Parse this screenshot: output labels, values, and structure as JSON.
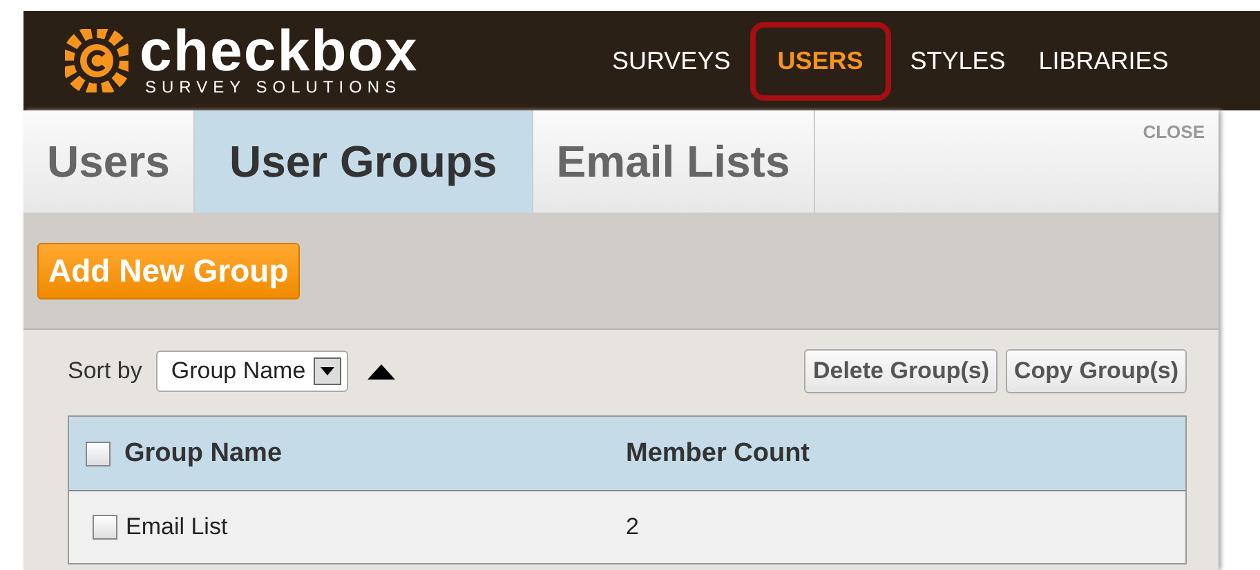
{
  "logo": {
    "name": "checkbox",
    "tagline": "SURVEY SOLUTIONS"
  },
  "nav": [
    {
      "label": "SURVEYS",
      "selected": false
    },
    {
      "label": "USERS",
      "selected": true
    },
    {
      "label": "STYLES",
      "selected": false
    },
    {
      "label": "LIBRARIES",
      "selected": false
    }
  ],
  "tabs": [
    {
      "label": "Users",
      "selected": false
    },
    {
      "label": "User Groups",
      "selected": true
    },
    {
      "label": "Email Lists",
      "selected": false
    }
  ],
  "close": "CLOSE",
  "add_button": "Add New Group",
  "sort": {
    "label": "Sort by",
    "value": "Group Name"
  },
  "actions": [
    "Delete Group(s)",
    "Copy Group(s)"
  ],
  "table": {
    "columns": [
      "Group Name",
      "Member Count"
    ],
    "all_checked": false,
    "rows": [
      {
        "name": "Email List",
        "count": "2",
        "checked": false
      }
    ]
  }
}
